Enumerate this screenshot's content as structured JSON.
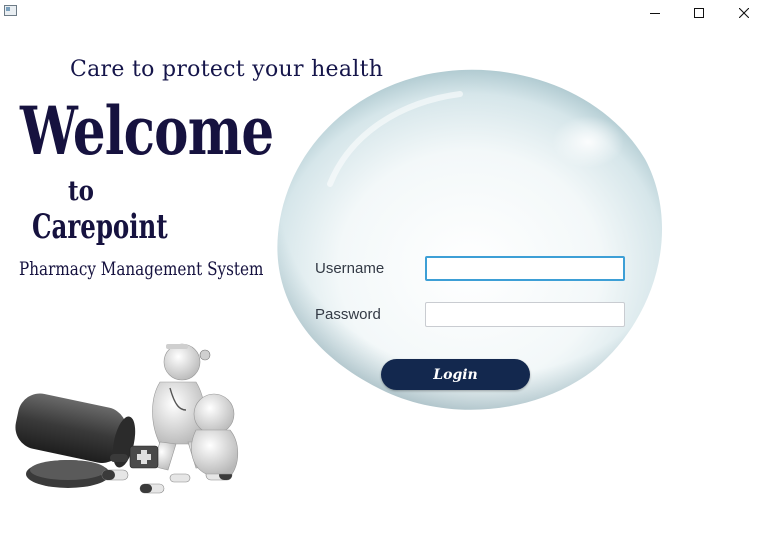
{
  "window": {
    "icon": "app-icon",
    "controls": [
      "minimize-icon",
      "maximize-icon",
      "close-icon"
    ]
  },
  "branding": {
    "tagline": "Care to protect your health",
    "welcome": "Welcome",
    "to": "to",
    "name": "Carepoint",
    "subtitle": "Pharmacy Management System"
  },
  "login_form": {
    "username_label": "Username",
    "username_value": "",
    "password_label": "Password",
    "password_value": "",
    "login_label": "Login"
  },
  "colors": {
    "heading": "#16123f",
    "login_button": "#13284e",
    "focus_border": "#3d9fd6"
  }
}
